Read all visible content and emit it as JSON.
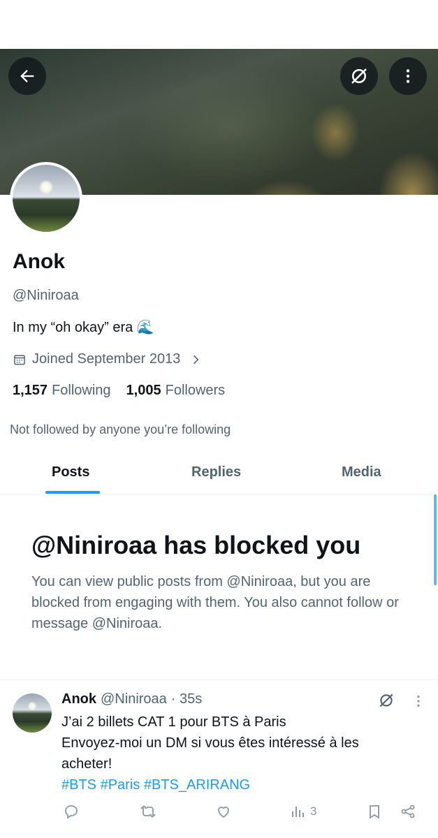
{
  "profile": {
    "name": "Anok",
    "handle": "@Niniroaa",
    "bio": "In my “oh okay” era 🌊",
    "joined": "Joined September 2013",
    "following_count": "1,157",
    "following_label": "Following",
    "followers_count": "1,005",
    "followers_label": "Followers",
    "not_followed": "Not followed by anyone you’re following"
  },
  "tabs": [
    "Posts",
    "Replies",
    "Media"
  ],
  "blocked": {
    "title": "@Niniroaa has blocked you",
    "text": "You can view public posts from @Niniroaa, but you are blocked from engaging with them. You also cannot follow or message @Niniroaa."
  },
  "post": {
    "name": "Anok",
    "handle": "@Niniroaa",
    "time": "· 35s",
    "line1": "J’ai 2 billets CAT 1 pour BTS à Paris",
    "line2": "Envoyez-moi un DM si vous êtes intéressé à les acheter!",
    "hashtags": "#BTS #Paris #BTS_ARIRANG",
    "views": "3"
  },
  "icons": {
    "back": "arrow-left-icon",
    "grok": "grok-icon",
    "more": "more-vertical-icon",
    "calendar": "calendar-icon",
    "chevron": "chevron-right-icon",
    "reply": "reply-icon",
    "repost": "repost-icon",
    "like": "heart-icon",
    "views": "views-icon",
    "bookmark": "bookmark-icon",
    "share": "share-icon"
  },
  "colors": {
    "accent": "#1d9bf0",
    "secondary_text": "#536471",
    "primary_text": "#0f1419"
  }
}
